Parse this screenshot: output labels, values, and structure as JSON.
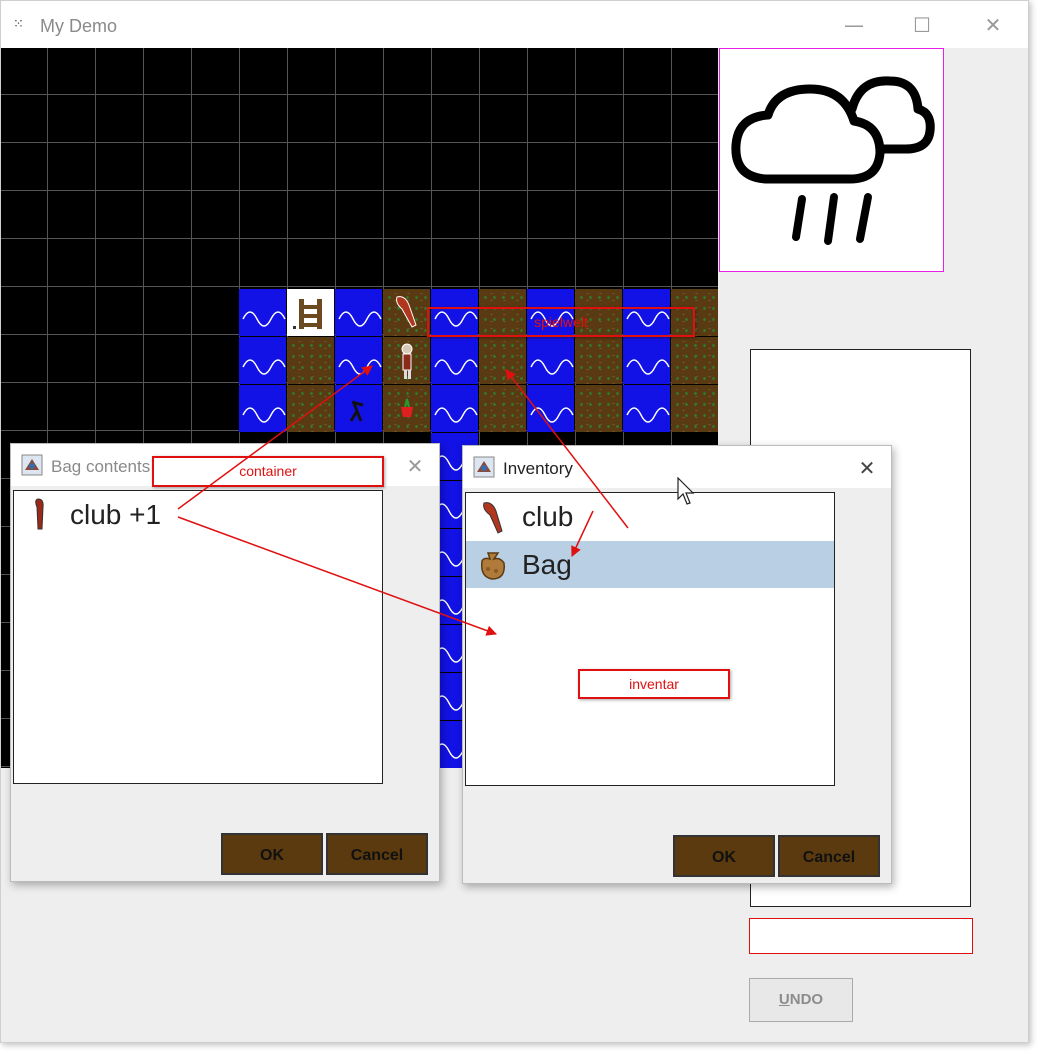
{
  "window": {
    "title": "My Demo",
    "app_icon": "⁙",
    "minimize": "—",
    "maximize": "☐",
    "close": "✕"
  },
  "annotations": {
    "spielwelt": "spielwelt",
    "container": "container",
    "inventar": "inventar"
  },
  "weather": {
    "icon": "rain-cloud-icon"
  },
  "undo": {
    "label": "UNDO"
  },
  "bag_dialog": {
    "title": "Bag contents",
    "close": "✕",
    "items": [
      {
        "label": "club +1",
        "icon": "club-icon"
      }
    ],
    "ok": "OK",
    "cancel": "Cancel"
  },
  "inventory_dialog": {
    "title": "Inventory",
    "close": "✕",
    "items": [
      {
        "label": "club",
        "icon": "club-icon",
        "selected": false
      },
      {
        "label": "Bag",
        "icon": "bag-icon",
        "selected": true
      }
    ],
    "ok": "OK",
    "cancel": "Cancel"
  },
  "colors": {
    "water": "#1212e6",
    "dirt": "#5a3a12",
    "annotation": "#e01010",
    "selection": "#b8cfe4",
    "button_brown": "#5a3a0e",
    "weather_border": "#e61ee6"
  }
}
